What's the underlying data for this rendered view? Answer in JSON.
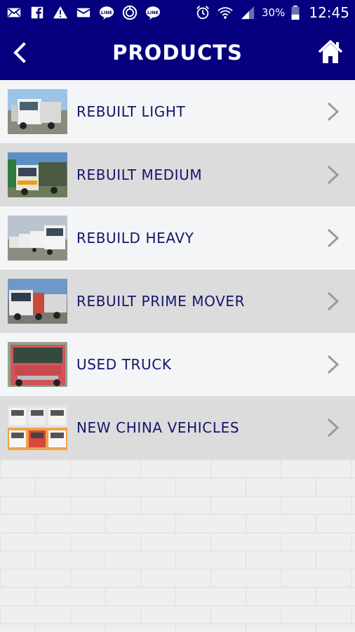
{
  "status_bar": {
    "battery_pct": "30%",
    "time": "12:45",
    "icons_left": [
      "mail-icon",
      "facebook-icon",
      "warning-icon",
      "email-icon",
      "line-icon",
      "sync-icon",
      "line-icon"
    ],
    "icons_right": [
      "alarm-icon",
      "wifi-icon",
      "signal-icon",
      "battery-icon"
    ]
  },
  "header": {
    "title": "PRODUCTS",
    "back_icon": "chevron-left-icon",
    "home_icon": "home-icon",
    "bg_color": "#07007e"
  },
  "products": [
    {
      "label": "REBUILT LIGHT"
    },
    {
      "label": "REBUILT MEDIUM"
    },
    {
      "label": "REBUILD HEAVY"
    },
    {
      "label": "REBUILT PRIME MOVER"
    },
    {
      "label": "USED TRUCK"
    },
    {
      "label": "NEW CHINA VEHICLES"
    }
  ],
  "colors": {
    "label": "#15156a",
    "row_light": "#f4f5f6",
    "row_dark": "#dcdcdd",
    "chevron": "#9a9a9a"
  }
}
